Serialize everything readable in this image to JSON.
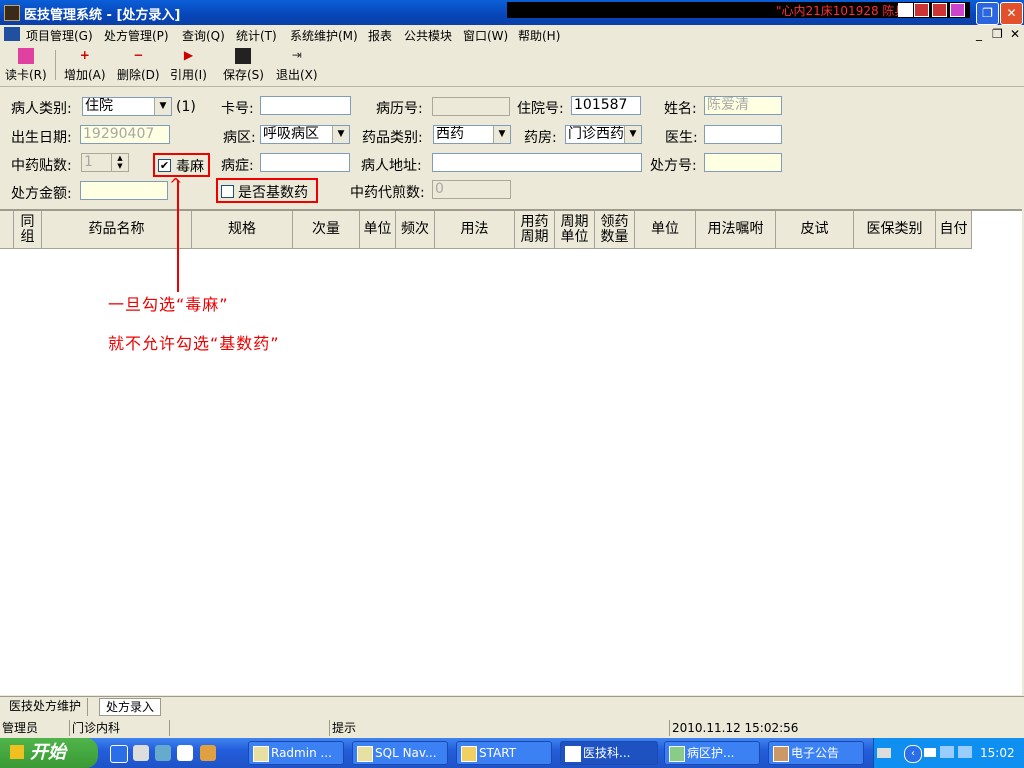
{
  "window": {
    "title": "医技管理系统 - [处方录入]",
    "status_text": "\"心内21床101928 陈兵"
  },
  "menu": [
    "项目管理(G)",
    "处方管理(P)",
    "查询(Q)",
    "统计(T)",
    "系统维护(M)",
    "报表",
    "公共模块",
    "窗口(W)",
    "帮助(H)"
  ],
  "toolbar": [
    "读卡(R)",
    "增加(A)",
    "删除(D)",
    "引用(I)",
    "保存(S)",
    "退出(X)"
  ],
  "form": {
    "patient_type_label": "病人类别:",
    "patient_type_value": "住院",
    "patient_type_code": "(1)",
    "card_no_label": "卡号:",
    "card_no_value": "",
    "record_no_label": "病历号:",
    "record_no_value": "",
    "inpatient_no_label": "住院号:",
    "inpatient_no_value": "101587",
    "name_label": "姓名:",
    "name_value": "陈爱清",
    "birth_label": "出生日期:",
    "birth_value": "19290407",
    "ward_label": "病区:",
    "ward_value": "呼吸病区",
    "drug_type_label": "药品类别:",
    "drug_type_value": "西药",
    "pharmacy_label": "药房:",
    "pharmacy_value": "门诊西药",
    "doctor_label": "医生:",
    "doctor_value": "",
    "tcm_doses_label": "中药贴数:",
    "tcm_doses_value": "1",
    "narcotic_label": "毒麻",
    "disease_label": "病症:",
    "disease_value": "",
    "address_label": "病人地址:",
    "address_value": "",
    "rx_no_label": "处方号:",
    "rx_no_value": "",
    "amount_label": "处方金额:",
    "amount_value": "",
    "basic_drug_label": "是否基数药",
    "decoction_label": "中药代煎数:",
    "decoction_value": "0"
  },
  "grid_columns": [
    "同组",
    "药品名称",
    "规格",
    "次量",
    "单位",
    "频次",
    "用法",
    "用药周期",
    "周期单位",
    "领药数量",
    "单位",
    "用法嘱咐",
    "皮试",
    "医保类别",
    "自付"
  ],
  "annotation": {
    "line1": "一旦勾选“毒麻”",
    "line2": "就不允许勾选“基数药”"
  },
  "tabs": [
    "医技处方维护",
    "处方录入"
  ],
  "statusbar": {
    "user": "管理员",
    "dept": "门诊内科",
    "hint": "提示",
    "datetime": "2010.11.12 15:02:56"
  },
  "taskbar": {
    "start_label": "开始",
    "tasks": [
      "Radmin ...",
      "SQL Nav...",
      "START",
      "医技科...",
      "病区护...",
      "电子公告"
    ],
    "clock": "15:02"
  },
  "colors": {
    "accent_red": "#e00000",
    "title_blue": "#0a5fd8",
    "taskbar_blue": "#245edb"
  }
}
